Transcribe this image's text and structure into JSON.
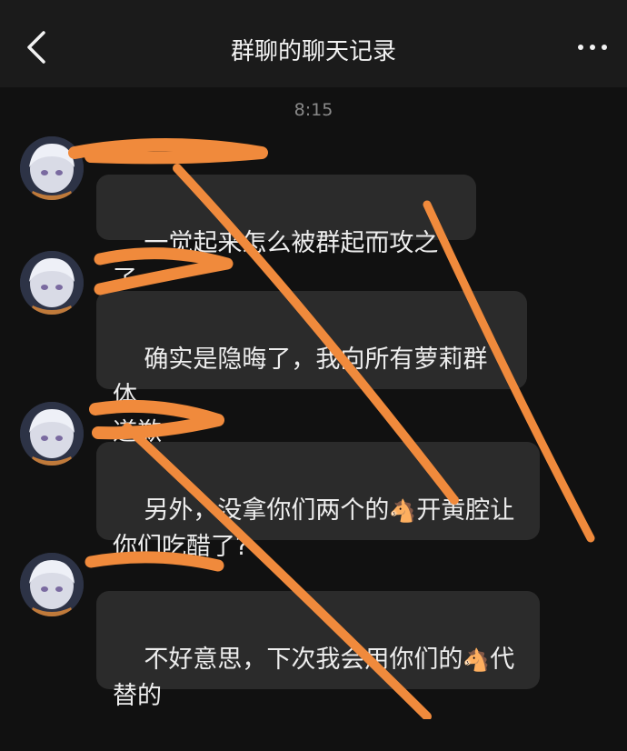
{
  "header": {
    "back_icon": "chevron-left-icon",
    "title": "群聊的聊天记录",
    "more_icon": "more-dots-icon"
  },
  "timestamp": "8:15",
  "messages": [
    {
      "sender": "",
      "text": "一觉起来怎么被群起而攻之了"
    },
    {
      "sender": "",
      "text": "确实是隐晦了，我向所有萝莉群体\n道歉"
    },
    {
      "sender": "",
      "text_before": "另外，没拿你们两个的",
      "emoji": "🐴",
      "text_after": "开黄腔让\n你们吃醋了?"
    },
    {
      "sender": "",
      "text_before": "不好意思，下次我会用你们的",
      "emoji": "🐴",
      "text_after": "代\n替的"
    }
  ],
  "colors": {
    "background": "#111111",
    "header": "#1b1b1b",
    "bubble": "#2b2b2b",
    "scribble": "#f08a3c"
  }
}
